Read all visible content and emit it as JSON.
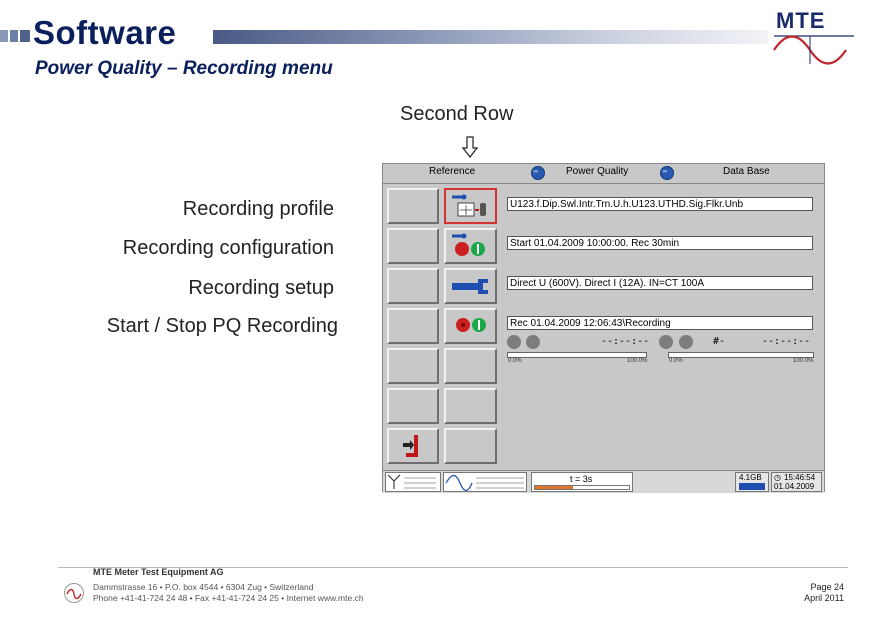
{
  "header": {
    "title": "Software",
    "subtitle": "Power Quality – Recording menu",
    "logo_text": "MTE"
  },
  "callout": {
    "second_row": "Second Row"
  },
  "row_labels": [
    "Recording profile",
    "Recording configuration",
    "Recording setup",
    "Start / Stop PQ Recording"
  ],
  "screen": {
    "tabs": [
      "Reference",
      "Power Quality",
      "Data Base"
    ],
    "fields": {
      "profile": "U123.f.Dip.Swl.Intr.Trn.U.h.U123.UTHD.Sig.Flkr.Unb",
      "configuration": "Start 01.04.2009 10:00:00. Rec 30min",
      "setup": "Direct U (600V). Direct I (12A). IN=CT 100A",
      "recording": "Rec 01.04.2009 12:06:43\\Recording"
    },
    "progress": {
      "left_start": "0.0%",
      "left_end": "100.0%",
      "right_start": "0.0%",
      "right_end": "100.0%",
      "counter_left": "--:--:--",
      "counter_badge": "#-",
      "counter_right": "--:--:--"
    },
    "status": {
      "time_label": "t = 3s",
      "storage": "4.1GB",
      "clock_time": "15:46:54",
      "clock_date": "01.04.2009"
    }
  },
  "footer": {
    "company": "MTE Meter Test Equipment AG",
    "address_line1": "Dammstrasse 16 • P.O. box 4544 • 6304 Zug • Switzerland",
    "address_line2": "Phone +41-41-724 24 48 • Fax +41-41-724 24 25 • Internet www.mte.ch",
    "page": "Page 24",
    "date": "April 2011"
  },
  "colors": {
    "title": "#0a1f5c",
    "selected_border": "#d23232",
    "icon_blue": "#1e4fb0",
    "status_red": "#cc2020",
    "status_green": "#1aa84a"
  }
}
